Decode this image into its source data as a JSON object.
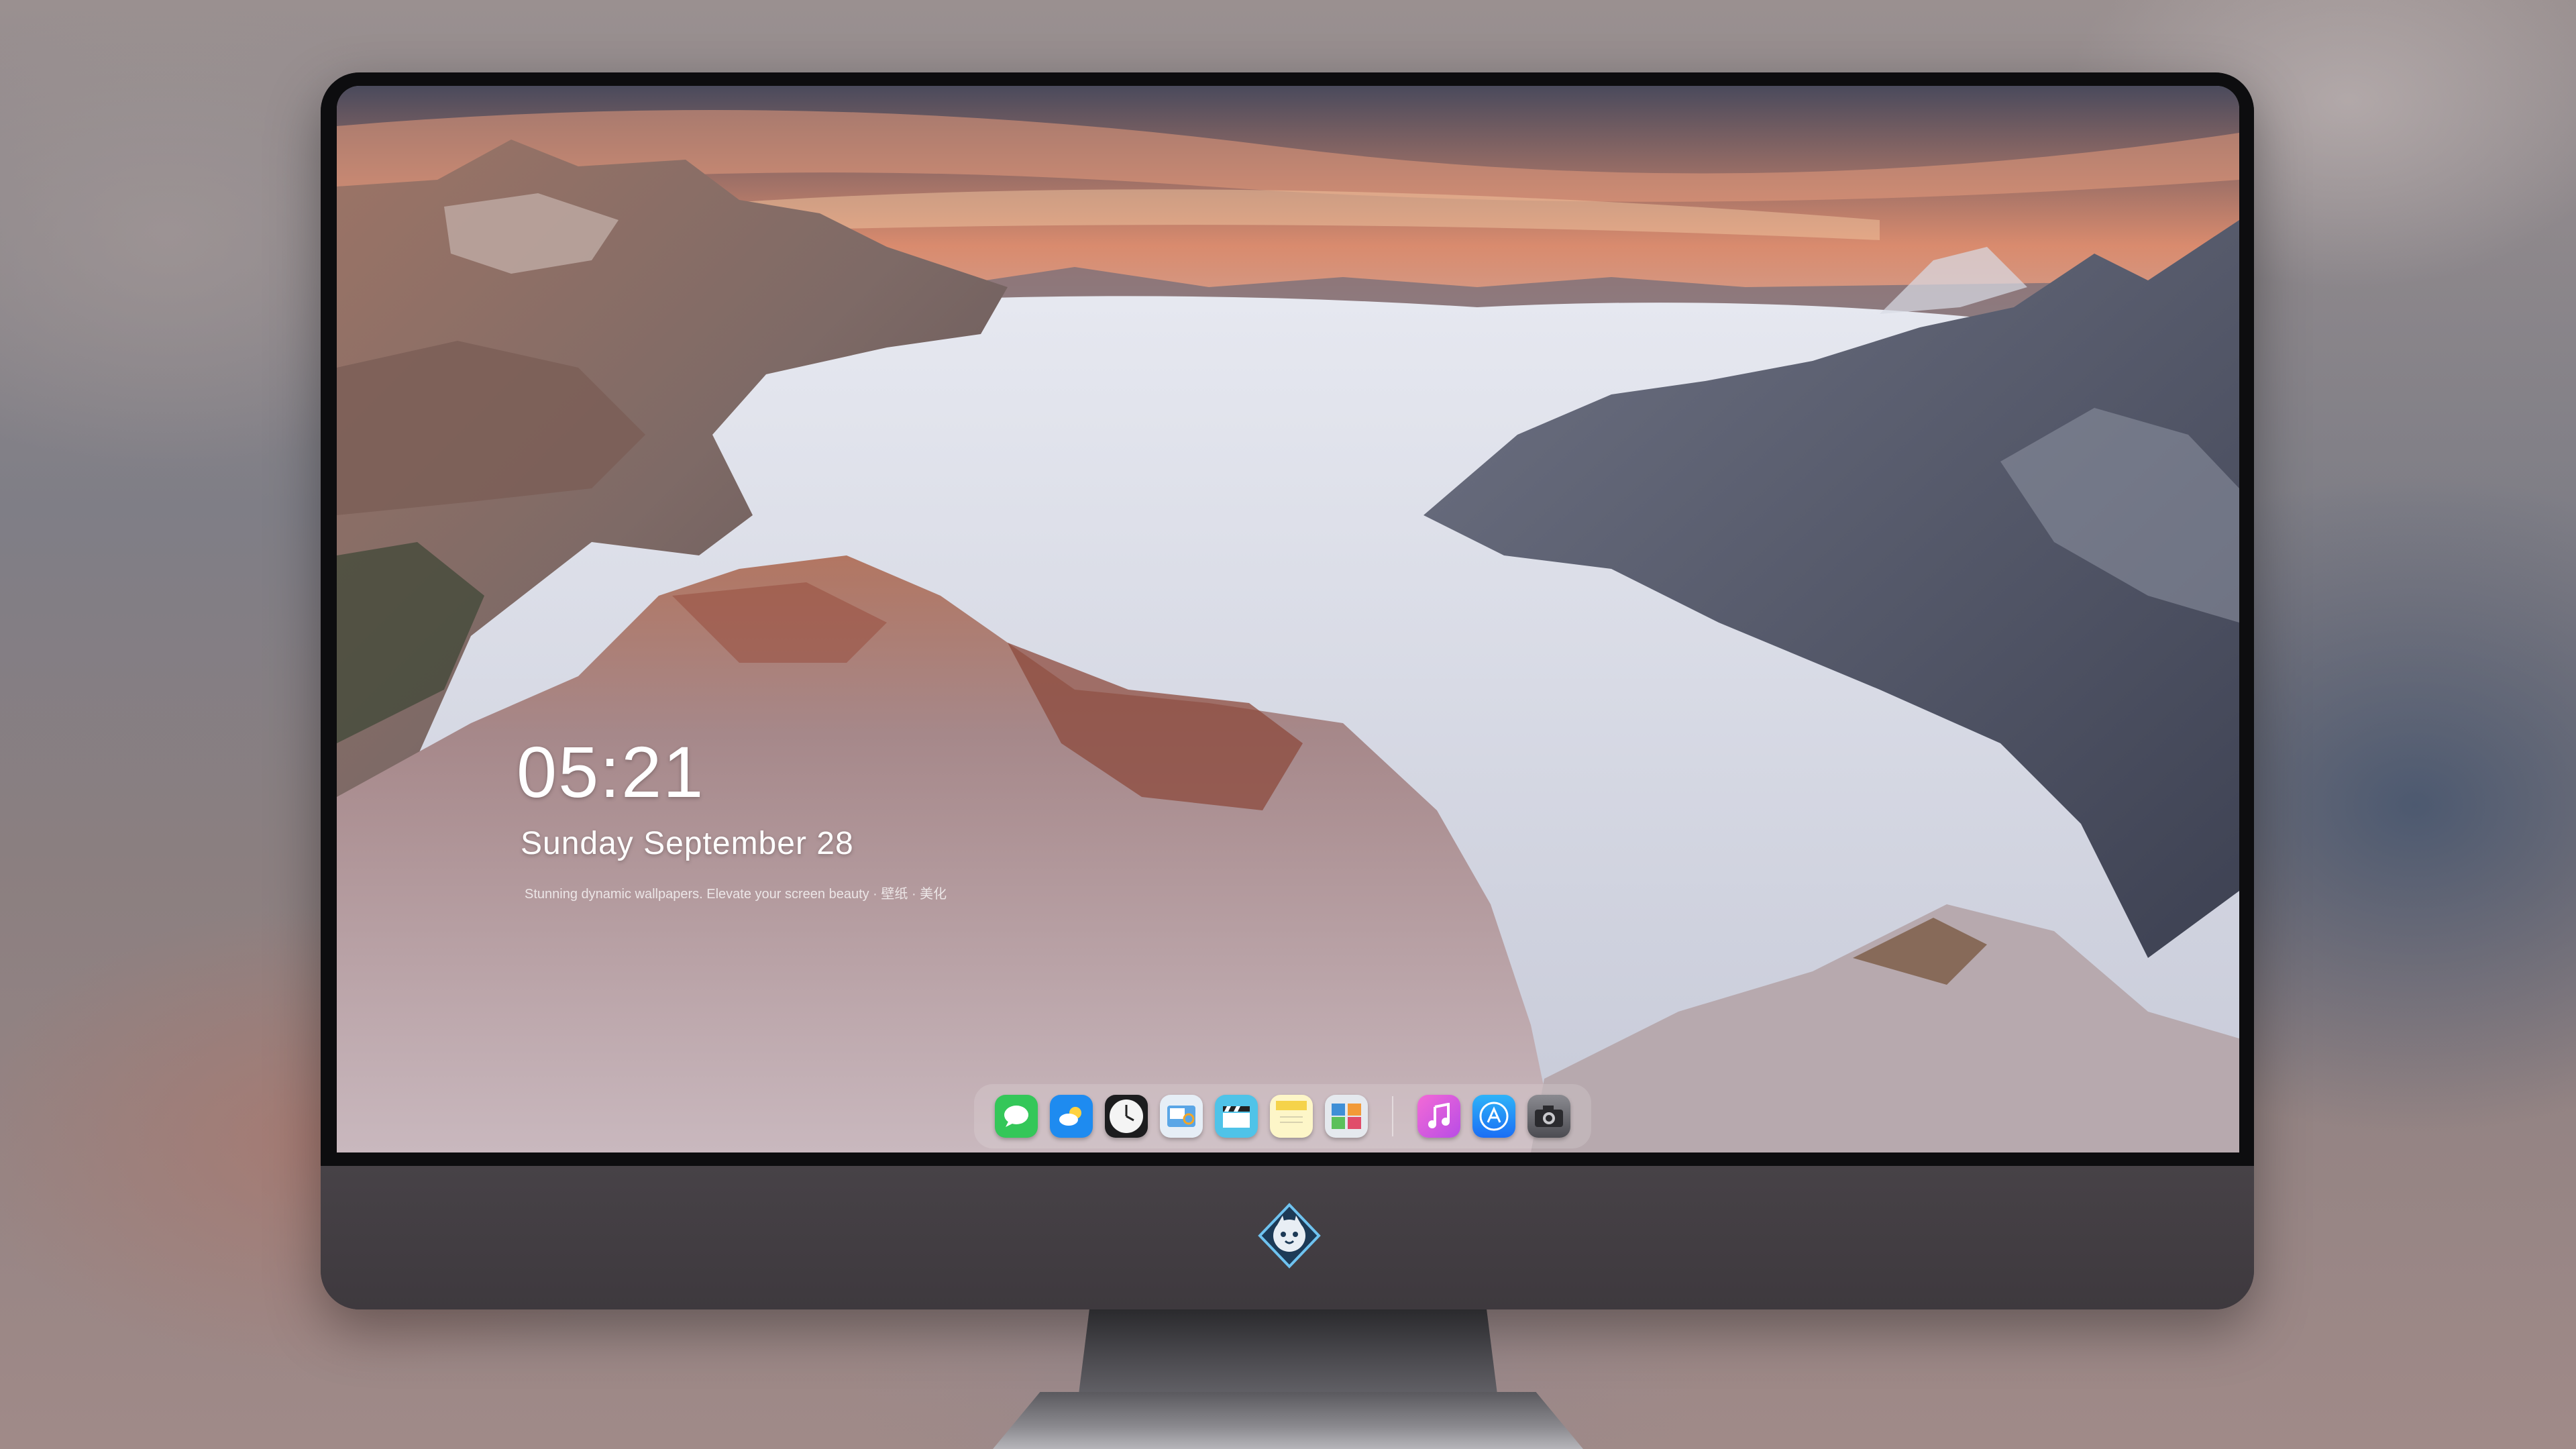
{
  "lock_screen": {
    "time": "05:21",
    "date": "Sunday September 28",
    "caption": "Stunning dynamic wallpapers. Elevate your screen beauty · 壁纸 · 美化"
  },
  "dock": {
    "apps": [
      {
        "name": "Messages",
        "icon": "messages-icon",
        "glyph": "",
        "color": "#34c759"
      },
      {
        "name": "Weather",
        "icon": "weather-icon",
        "glyph": "",
        "color": "#1e8bf0"
      },
      {
        "name": "Clock",
        "icon": "clock-icon",
        "glyph": "",
        "color": "#f2f2f2"
      },
      {
        "name": "Preview",
        "icon": "preview-icon",
        "glyph": "",
        "color": "#5aa6e6"
      },
      {
        "name": "Clips",
        "icon": "clapperboard-icon",
        "glyph": "",
        "color": "#4fc3e8"
      },
      {
        "name": "Notes",
        "icon": "notes-icon",
        "glyph": "",
        "color": "#f5d34a"
      },
      {
        "name": "Photo Booth",
        "icon": "photo-booth-icon",
        "glyph": "",
        "color": "#3f8fd6"
      },
      {
        "name": "Music",
        "icon": "music-icon",
        "glyph": "♫",
        "color": "#e34ad8"
      },
      {
        "name": "App Store",
        "icon": "app-store-icon",
        "glyph": "A",
        "color": "#1a8ef5"
      },
      {
        "name": "Camera",
        "icon": "camera-icon",
        "glyph": "",
        "color": "#5c5c62"
      }
    ]
  },
  "colors": {
    "monitor_chin": "#423d42",
    "bezel": "#0d0d0f"
  }
}
